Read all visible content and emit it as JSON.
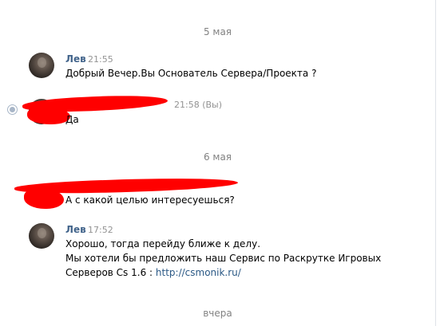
{
  "dates": {
    "first": "5 мая",
    "second": "6 мая",
    "third": "вчера"
  },
  "messages": [
    {
      "author": "Лев",
      "time": "21:55",
      "text": "Добрый Вечер.Вы Основатель Сервера/Проекта ?"
    },
    {
      "author": "",
      "time": "21:58 (Вы)",
      "text": "Да"
    },
    {
      "author": "",
      "time": "",
      "text": "А с какой целью интересуешься?"
    },
    {
      "author": "Лев",
      "time": "17:52",
      "lines": [
        "Хорошо, тогда перейду ближе к делу.",
        "Мы хотели бы предложить наш Сервис по Раскрутке Игровых",
        "Серверов Cs 1.6 : "
      ],
      "link": "http://csmonik.ru/"
    }
  ],
  "colors": {
    "author": "#42648b",
    "link": "#2a5885",
    "meta": "#939393",
    "redaction": "#ff0000"
  }
}
